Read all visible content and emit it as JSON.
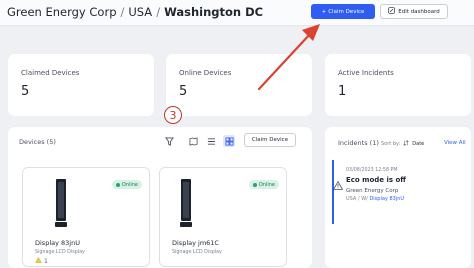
{
  "breadcrumb": {
    "org": "Green Energy Corp",
    "country": "USA",
    "site": "Washington DC",
    "separator": "/"
  },
  "toolbar": {
    "claim_label": "Claim Device",
    "claim_prefix": "+",
    "edit_label": "Edit dashboard"
  },
  "stats": [
    {
      "label": "Claimed Devices",
      "value": "5"
    },
    {
      "label": "Online Devices",
      "value": "5"
    },
    {
      "label": "Active Incidents",
      "value": "1"
    }
  ],
  "devices": {
    "title": "Devices (5)",
    "claim_label": "Claim Device",
    "cards": [
      {
        "name": "Display 83jnU",
        "type": "Signage LCD Display",
        "status": "Online",
        "warnings": "1"
      },
      {
        "name": "Display jm61C",
        "type": "Signage LCD Display",
        "status": "Online"
      }
    ]
  },
  "incidents": {
    "title": "Incidents (1)",
    "sort_label": "Sort by:",
    "sort_value": "Date",
    "view_all": "View All",
    "items": [
      {
        "timestamp": "03/08/2023 12:58 PM",
        "message": "Eco mode is off",
        "org": "Green Energy Corp",
        "path_prefix": "USA / W/",
        "device_link": "Display 83jnU"
      }
    ]
  },
  "annotation": {
    "step": "3"
  },
  "colors": {
    "primary": "#2f5cf1",
    "online": "#27a56f",
    "annotation": "#c0392b"
  }
}
